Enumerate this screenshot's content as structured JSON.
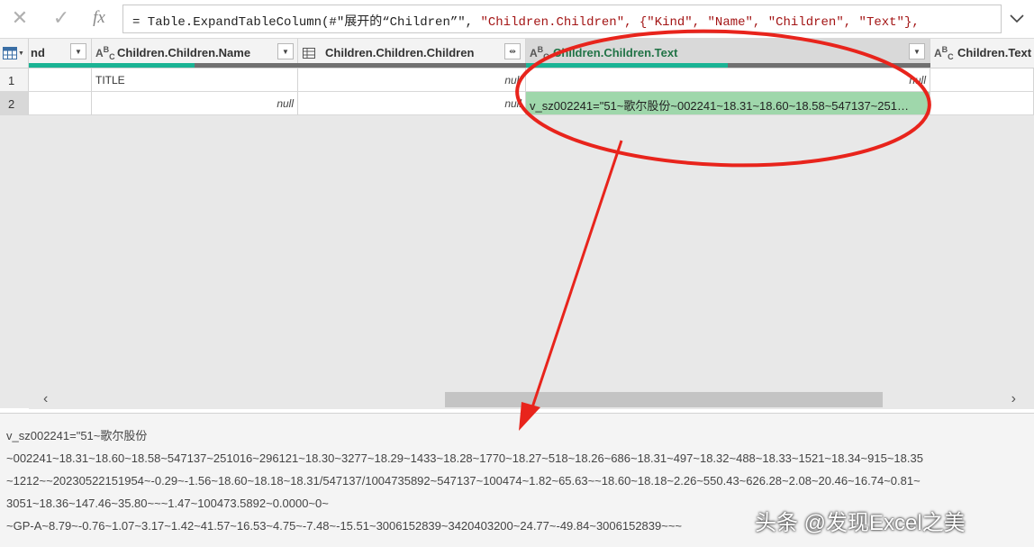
{
  "formula_bar": {
    "cancel_icon": "close-icon",
    "confirm_icon": "check-icon",
    "fx_label": "fx",
    "formula_prefix": "= Table.ExpandTableColumn(#\"展开的“Children”\", ",
    "formula_args": "\"Children.Children\", {\"Kind\", \"Name\", \"Children\", \"Text\"},"
  },
  "columns": [
    {
      "label": "nd",
      "type": "table-icon"
    },
    {
      "label": "Children.Children.Name",
      "type": "text"
    },
    {
      "label": "Children.Children.Children",
      "type": "table"
    },
    {
      "label": "Children.Children.Text",
      "type": "text",
      "selected": true
    },
    {
      "label": "Children.Text",
      "type": "text"
    }
  ],
  "type_icon_text": {
    "a": "A",
    "b": "B",
    "c": "C"
  },
  "rows": [
    {
      "num": "1",
      "name": "TITLE",
      "children": "null",
      "text": "null"
    },
    {
      "num": "2",
      "name": "null",
      "children": "null",
      "text": "v_sz002241=\"51~歌尔股份~002241~18.31~18.60~18.58~547137~251…"
    }
  ],
  "scrollbar": {
    "left": "‹",
    "right": "›"
  },
  "preview": {
    "lines": [
      "v_sz002241=\"51~歌尔股份",
      "~002241~18.31~18.60~18.58~547137~251016~296121~18.30~3277~18.29~1433~18.28~1770~18.27~518~18.26~686~18.31~497~18.32~488~18.33~1521~18.34~915~18.35",
      "~1212~~20230522151954~-0.29~-1.56~18.60~18.18~18.31/547137/1004735892~547137~100474~1.82~65.63~~18.60~18.18~2.26~550.43~626.28~2.08~20.46~16.74~0.81~",
      "3051~18.36~147.46~35.80~~~1.47~100473.5892~0.0000~0~",
      "~GP-A~8.79~-0.76~1.07~3.17~1.42~41.57~16.53~4.75~-7.48~-15.51~3006152839~3420403200~24.77~-49.84~3006152839~~~"
    ]
  },
  "watermark": "头条 @发现Excel之美",
  "colors": {
    "accent_green": "#217346",
    "quality_teal": "#1ab394",
    "selected_cell": "#9fd7ab",
    "annotation_red": "#e8241c"
  }
}
